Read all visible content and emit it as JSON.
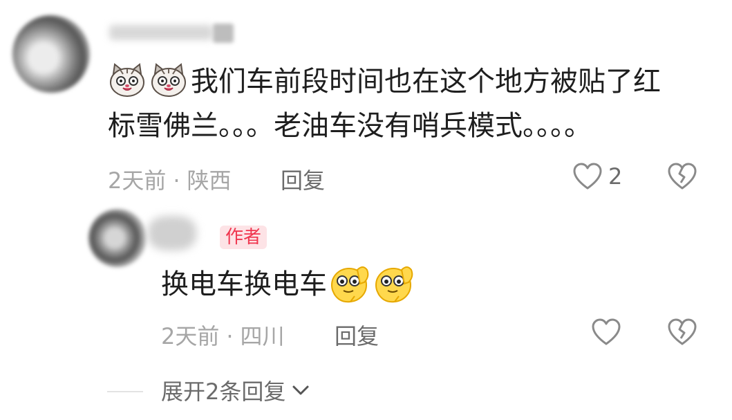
{
  "comment": {
    "text_line1": "我们车前段时间也在这个地方被贴了红",
    "text_line2": "标雪佛兰。。。老油车没有哨兵模式。。。。",
    "time": "2天前",
    "separator": "·",
    "location": "陕西",
    "reply_label": "回复",
    "like_count": "2",
    "emoji": "cat-face-emoji"
  },
  "reply": {
    "badge": "作者",
    "text": "换电车换电车",
    "time": "2天前",
    "separator": "·",
    "location": "四川",
    "reply_label": "回复",
    "emoji": "hand-peek-emoji"
  },
  "expand": {
    "label": "展开2条回复"
  },
  "colors": {
    "badge_text": "#f0364f",
    "badge_bg": "#fde3e6",
    "meta_text": "#a6a6a6",
    "icon_stroke": "#8a8a8a"
  }
}
